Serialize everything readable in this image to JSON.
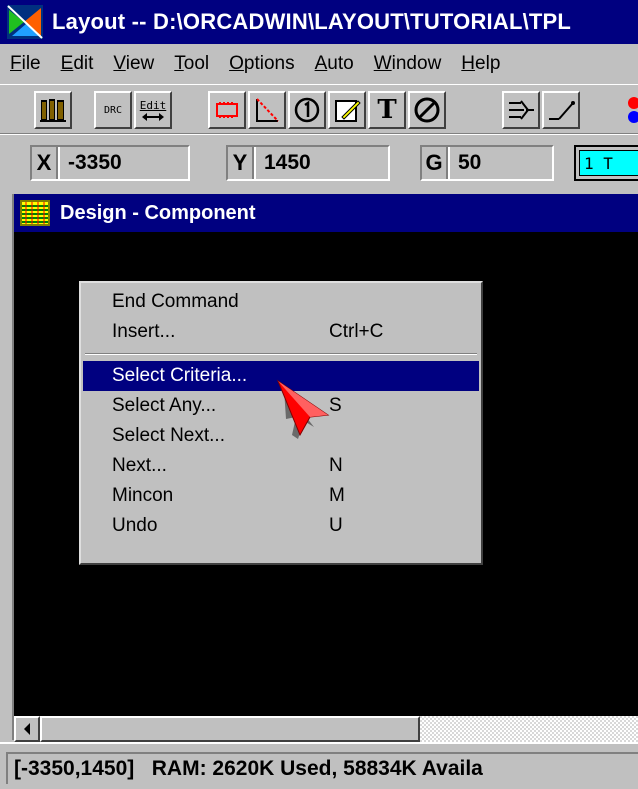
{
  "window": {
    "title": "Layout -- D:\\ORCADWIN\\LAYOUT\\TUTORIAL\\TPL"
  },
  "menubar": {
    "items": [
      {
        "first": "F",
        "rest": "ile"
      },
      {
        "first": "E",
        "rest": "dit"
      },
      {
        "first": "V",
        "rest": "iew"
      },
      {
        "first": "T",
        "rest": "ool"
      },
      {
        "first": "O",
        "rest": "ptions"
      },
      {
        "first": "A",
        "rest": "uto"
      },
      {
        "first": "W",
        "rest": "indow"
      },
      {
        "first": "H",
        "rest": "elp"
      }
    ]
  },
  "toolbar": {
    "drc_label": "DRC",
    "edit_label": "Edit",
    "text_label": "T"
  },
  "coords": {
    "x_label": "X",
    "x_value": "-3350",
    "y_label": "Y",
    "y_value": "1450",
    "g_label": "G",
    "g_value": "50",
    "layer_value": "1 T"
  },
  "design_window": {
    "title": "Design - Component"
  },
  "context_menu": {
    "end_command": "End Command",
    "insert": {
      "label": "Insert...",
      "shortcut": "Ctrl+C"
    },
    "select_criteria": {
      "label": "Select Criteria...",
      "shortcut": ""
    },
    "select_any": {
      "label": "Select Any...",
      "shortcut": "S"
    },
    "select_next": {
      "label": "Select Next...",
      "shortcut": ""
    },
    "next": {
      "label": "Next...",
      "shortcut": "N"
    },
    "mincon": {
      "label": "Mincon",
      "shortcut": "M"
    },
    "undo": {
      "label": "Undo",
      "shortcut": "U"
    }
  },
  "statusbar": {
    "text": "[-3350,1450]   RAM: 2620K Used, 58834K Availa"
  },
  "colors": {
    "titlebar": "#000080",
    "face": "#c0c0c0",
    "canvas": "#000000",
    "selection": "#000080",
    "cursor": "#ff0000"
  }
}
